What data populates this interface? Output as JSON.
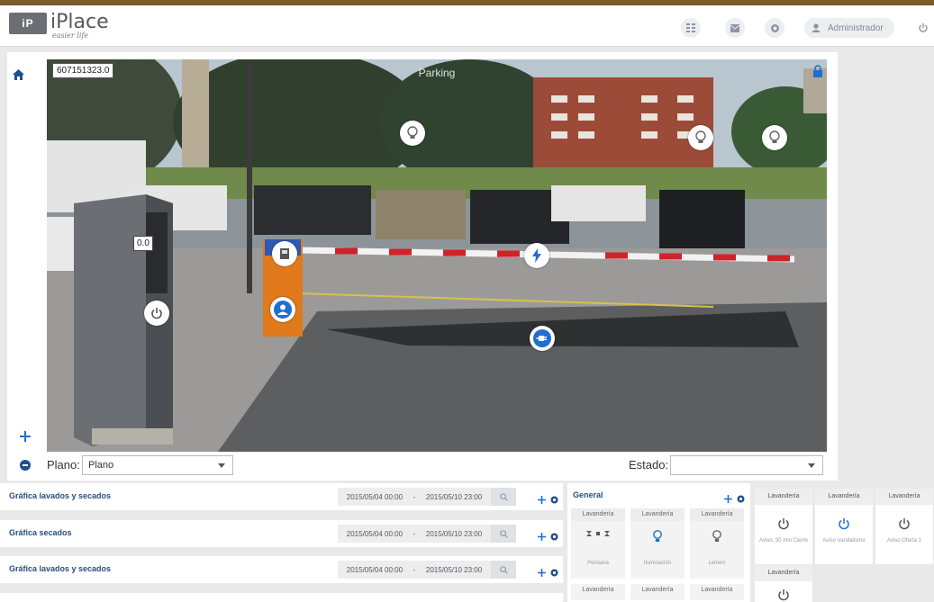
{
  "header": {
    "logo_mark": "iP",
    "logo_name": "iPlace",
    "logo_tagline": "easier life",
    "user_label": "Administrador"
  },
  "scene": {
    "title": "Parking",
    "meter_id": "607151323.0",
    "meter_value": "0.0"
  },
  "filters": {
    "plano_label": "Plano:",
    "plano_value": "Plano",
    "estado_label": "Estado:",
    "estado_value": ""
  },
  "graphs": [
    {
      "title": "Gráfica lavados y secados",
      "from": "2015/05/04 00:00",
      "sep": "-",
      "to": "2015/05/10 23:00"
    },
    {
      "title": "Gráfica secados",
      "from": "2015/05/04 00:00",
      "sep": "-",
      "to": "2015/05/10 23:00"
    },
    {
      "title": "Gráfica lavados y secados",
      "from": "2015/05/04 00:00",
      "sep": "-",
      "to": "2015/05/10 23:00"
    }
  ],
  "general": {
    "title": "General",
    "tiles": [
      {
        "head": "Lavandería",
        "label": "Persiana",
        "icon": "blinds-icon"
      },
      {
        "head": "Lavandería",
        "label": "Iluminación",
        "icon": "bulb-icon"
      },
      {
        "head": "Lavandería",
        "label": "Letrero",
        "icon": "bulb-icon"
      }
    ],
    "lower_heads": [
      "Lavandería",
      "Lavandería",
      "Lavandería"
    ]
  },
  "alerts": {
    "tiles": [
      {
        "head": "Lavandería",
        "label": "Aviso, 30 min Cierre",
        "icon": "power-icon"
      },
      {
        "head": "Lavandería",
        "label": "Aviso Vandalismo",
        "icon": "power-icon"
      },
      {
        "head": "Lavandería",
        "label": "Aviso Oferta 1",
        "icon": "power-icon"
      },
      {
        "head": "Lavandería",
        "label": "",
        "icon": "power-icon"
      }
    ]
  },
  "colors": {
    "accent": "#2a4e7a",
    "icon_blue": "#1f6fd1",
    "header_bg": "#ffffff",
    "page_bg": "#e9e9ea"
  }
}
